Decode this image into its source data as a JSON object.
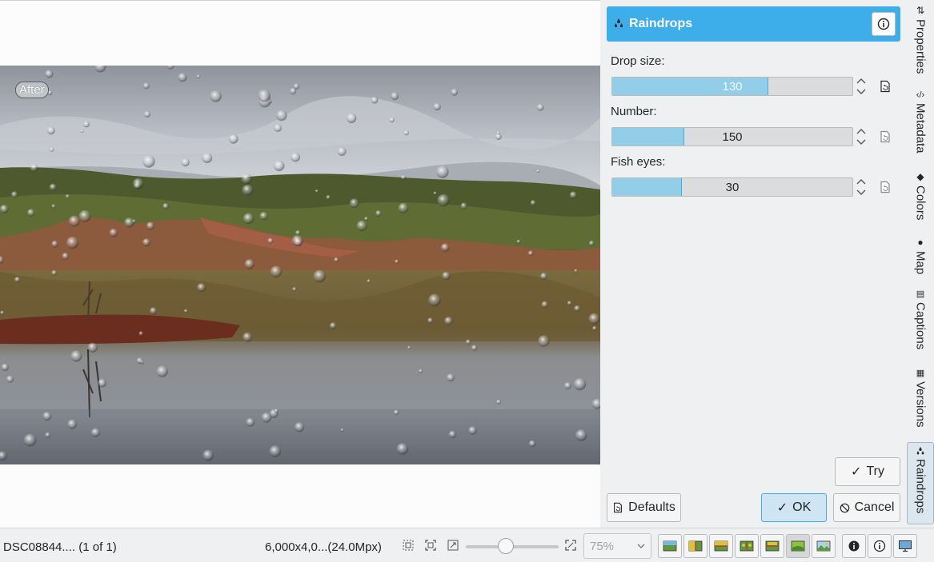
{
  "image": {
    "badge": "After"
  },
  "tool": {
    "title": "Raindrops",
    "header_color": "#3daee9",
    "info_icon": "info-icon",
    "params": [
      {
        "label": "Drop size:",
        "value": "130",
        "fraction": 0.65
      },
      {
        "label": "Number:",
        "value": "150",
        "fraction": 0.3
      },
      {
        "label": "Fish eyes:",
        "value": "30",
        "fraction": 0.29
      }
    ],
    "buttons": {
      "try": "Try",
      "defaults": "Defaults",
      "ok": "OK",
      "cancel": "Cancel"
    }
  },
  "sidebar_tabs": [
    {
      "label": "Properties",
      "icon": "properties-icon"
    },
    {
      "label": "Metadata",
      "icon": "metadata-icon"
    },
    {
      "label": "Colors",
      "icon": "colors-icon"
    },
    {
      "label": "Map",
      "icon": "globe-icon"
    },
    {
      "label": "Captions",
      "icon": "captions-icon"
    },
    {
      "label": "Versions",
      "icon": "versions-icon"
    },
    {
      "label": "Raindrops",
      "icon": "raindrops-icon",
      "active": true
    }
  ],
  "statusbar": {
    "file": "DSC08844.... (1 of 1)",
    "size": "6,000x4,0...(24.0Mpx)",
    "zoom": "75%"
  }
}
